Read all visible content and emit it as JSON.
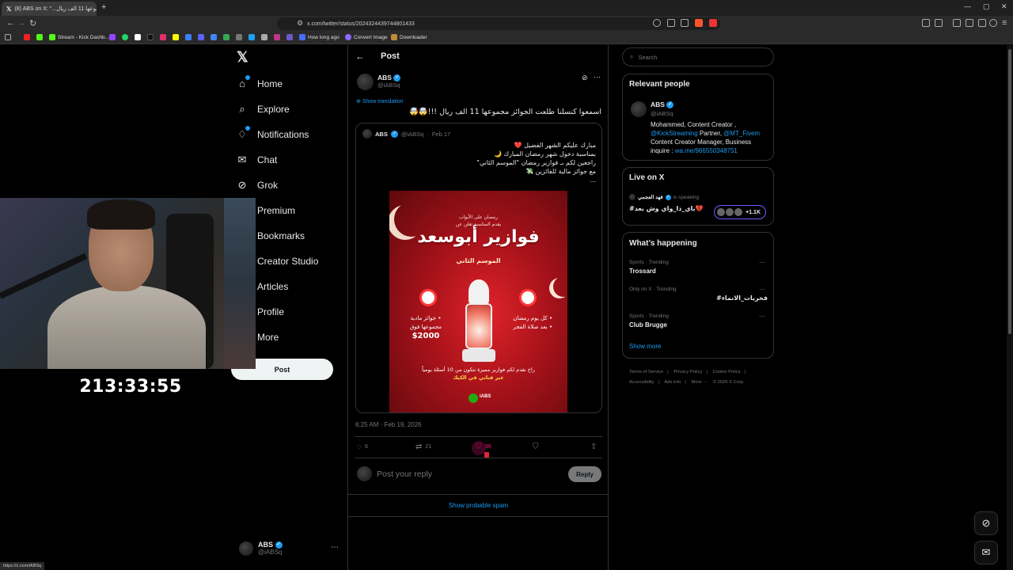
{
  "browser": {
    "tab_title": "(8) ABS on X: \"...مجموعها 11 الف ريال\"",
    "tab_icon": "x-icon",
    "url": "x.com/twitter/status/2024324439744801433",
    "bookmarks": [
      {
        "label": "Stream - Kick Dashb...",
        "color": "#53fc18"
      },
      {
        "label": "How long ago",
        "color": "#4a6cff"
      },
      {
        "label": "Convert Image",
        "color": "#8b6cff"
      },
      {
        "label": "Downloader",
        "color": "#c08a3a"
      }
    ],
    "status_url": "https://x.com/iABSq"
  },
  "nav": {
    "items": [
      {
        "label": "Home",
        "icon": "home-icon"
      },
      {
        "label": "Explore",
        "icon": "search-icon"
      },
      {
        "label": "Notifications",
        "icon": "bell-icon"
      },
      {
        "label": "Chat",
        "icon": "mail-icon"
      },
      {
        "label": "Grok",
        "icon": "grok-icon"
      },
      {
        "label": "Premium",
        "icon": "x-icon"
      },
      {
        "label": "Bookmarks",
        "icon": "bookmark-icon"
      },
      {
        "label": "Creator Studio",
        "icon": "studio-icon"
      },
      {
        "label": "Articles",
        "icon": "article-icon"
      },
      {
        "label": "Profile",
        "icon": "person-icon"
      },
      {
        "label": "More",
        "icon": "more-icon"
      }
    ],
    "post_button": "Post",
    "account": {
      "name": "ABS",
      "handle": "@iABSq"
    }
  },
  "stream": {
    "timer": "213:33:55"
  },
  "post": {
    "header_title": "Post",
    "author_name": "ABS",
    "author_handle": "@iABSq",
    "show_translation": "Show translation",
    "text": "اسمعوا كنسلنا طلعت الجوائز مجموعها 11 الف ريال !!!🤯🤯",
    "quote": {
      "name": "ABS",
      "handle": "@iABSq",
      "date": "Feb 17",
      "lines": [
        "مبارك عليكم الشهر الفضيل ❤️",
        "بمناسبة دخول شهر رمضان المبارك 🌙",
        "راجعين لكم بـ فوازير رمضان \"الموسم الثاني\"",
        "مع جوائز مالية للفائزين 💸",
        "..."
      ],
      "poster": {
        "top_line1": "رمضان على الأبواب",
        "top_line2": "يقدم المناسبة تعلن عن",
        "title": "فوازير أبوسعد",
        "season": "الموسم الثاني",
        "right_text1": "• كل يوم رمضان",
        "right_text2": "• بعد صلاة الفجر",
        "left_text1": "• جوائز مادية",
        "left_text2": "مجموعها فوق",
        "amount": "$2000",
        "bottom_line1": "راح نقدم لكم فوازير مميزة تتكون من 10 أسئلة يومياً",
        "bottom_line2": "عبر قناتي في الكيك",
        "logo_text": "iABS"
      }
    },
    "timestamp": "6:25 AM · Feb 19, 2026",
    "actions": {
      "replies": "6",
      "reposts": "21",
      "likes": "96"
    },
    "reply_placeholder": "Post your reply",
    "reply_button": "Reply",
    "show_spam": "Show probable spam"
  },
  "sidebar": {
    "search_placeholder": "Search",
    "relevant_title": "Relevant people",
    "relevant": {
      "name": "ABS",
      "handle": "@iABSq",
      "bio_1": "Mohammed, Content Creator ,",
      "bio_link1": "@KickStreaming",
      "bio_2": " Partner, ",
      "bio_link2": "@MT_Fivem",
      "bio_3": "Content Creator Manager, Business inquire : ",
      "bio_link3": "wa.me/966550348751"
    },
    "live_title": "Live on X",
    "live": {
      "host": "فهد العجمي",
      "status": "is speaking",
      "title": "#باي_ذا_واي وش بعد💔",
      "count": "+1.1K"
    },
    "happening_title": "What’s happening",
    "trends": [
      {
        "meta": "Sports · Trending",
        "name": "Trossard"
      },
      {
        "meta": "Only on X · Trending",
        "name": "#فخريات_الانماء"
      },
      {
        "meta": "Sports · Trending",
        "name": "Club Brugge"
      }
    ],
    "show_more": "Show more",
    "footer": [
      "Terms of Service",
      "|",
      "Privacy Policy",
      "|",
      "Cookie Policy",
      "|",
      "Accessibility",
      "|",
      "Ads info",
      "|",
      "More ···",
      "© 2026 X Corp."
    ]
  },
  "colors": {
    "accent": "#1d9bf0",
    "background": "#000000",
    "like": "#f91880"
  }
}
